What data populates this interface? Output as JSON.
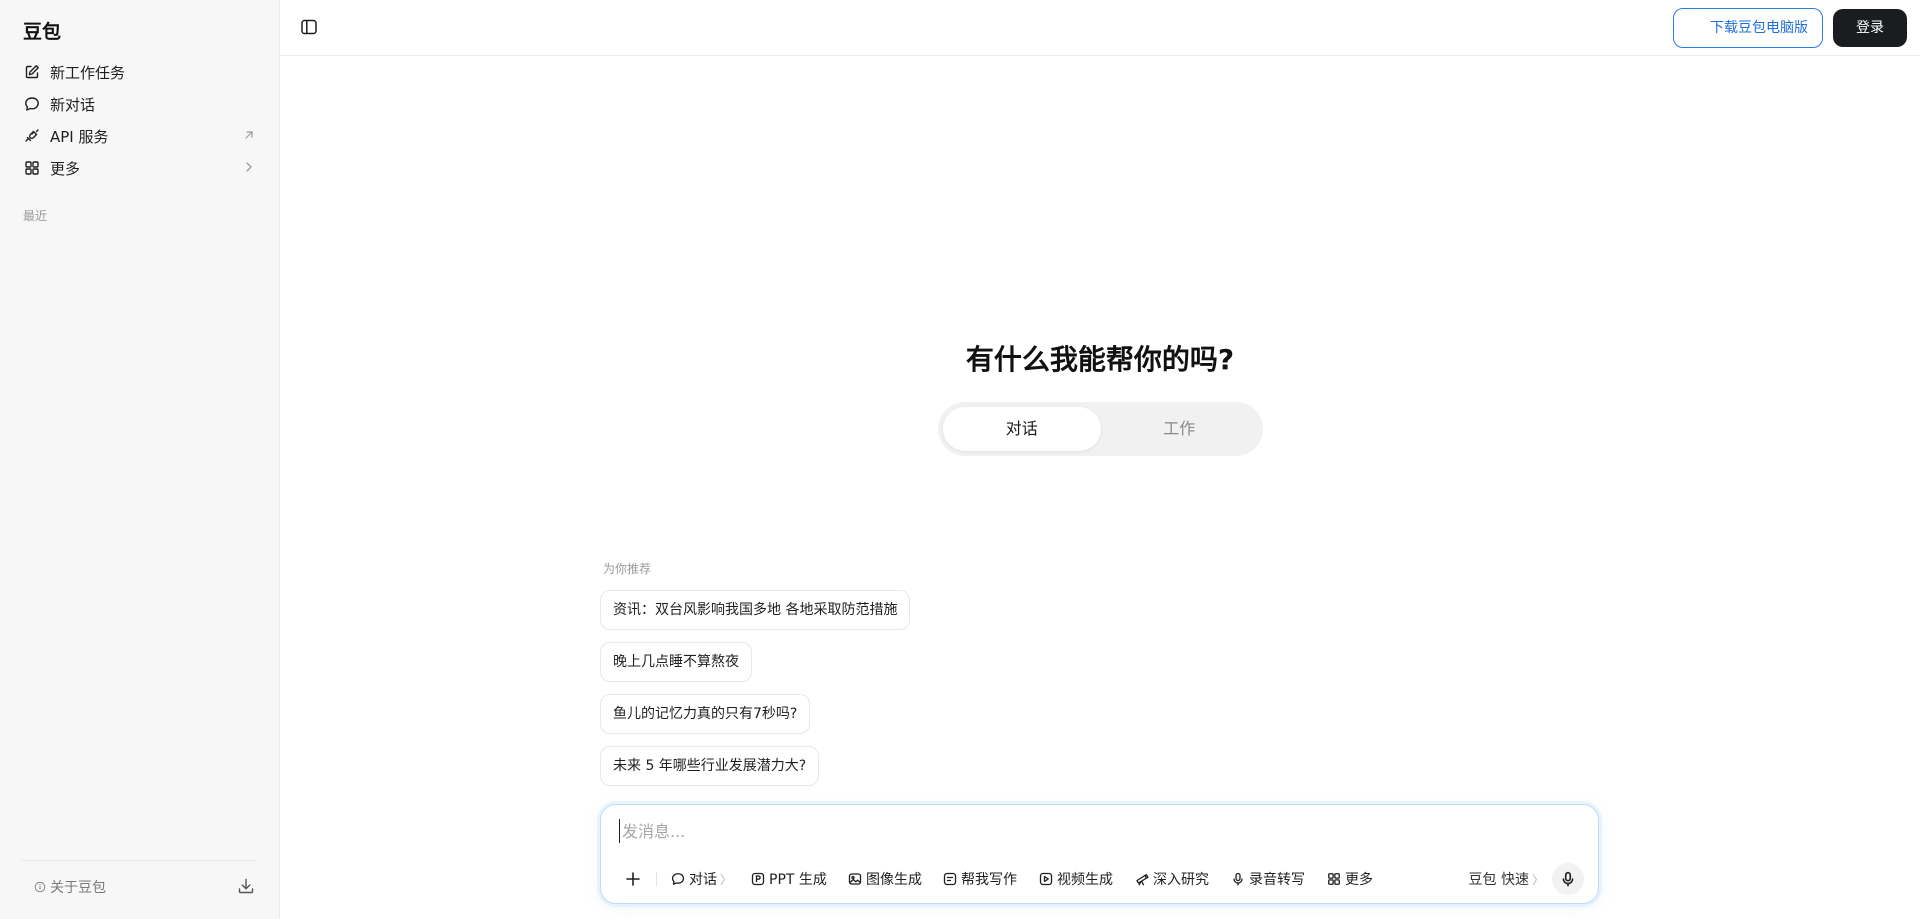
{
  "sidebar": {
    "brand": "豆包",
    "items": [
      {
        "label": "新工作任务",
        "icon": "edit-icon"
      },
      {
        "label": "新对话",
        "icon": "chat-bubble-icon"
      },
      {
        "label": "API 服务",
        "icon": "api-icon",
        "trailing_icon": "external-arrow-icon"
      },
      {
        "label": "更多",
        "icon": "grid-icon",
        "trailing_icon": "chevron-right-icon"
      }
    ],
    "recent_label": "最近",
    "footer": {
      "about_label": "关于豆包",
      "download_icon": "download-icon"
    }
  },
  "topbar": {
    "toggle_icon": "sidebar-toggle-icon",
    "download_button": "下载豆包电脑版",
    "login_button": "登录"
  },
  "main": {
    "headline": "有什么我能帮你的吗?",
    "mode_tabs": [
      {
        "label": "对话",
        "active": true
      },
      {
        "label": "工作",
        "active": false
      }
    ],
    "recommend_label": "为你推荐",
    "suggestions": [
      "资讯：双台风影响我国多地 各地采取防范措施",
      "晚上几点睡不算熬夜",
      "鱼儿的记忆力真的只有7秒吗?",
      "未来 5 年哪些行业发展潜力大?"
    ]
  },
  "composer": {
    "placeholder": "发消息...",
    "value": "",
    "tools": [
      {
        "label": "对话",
        "icon": "chat-bubble-icon",
        "has_chevron": true
      },
      {
        "label": "PPT 生成",
        "icon": "ppt-icon"
      },
      {
        "label": "图像生成",
        "icon": "image-icon"
      },
      {
        "label": "帮我写作",
        "icon": "write-icon"
      },
      {
        "label": "视频生成",
        "icon": "video-icon"
      },
      {
        "label": "深入研究",
        "icon": "telescope-icon"
      },
      {
        "label": "录音转写",
        "icon": "microphone-icon"
      },
      {
        "label": "更多",
        "icon": "grid-icon"
      }
    ],
    "model_label": "豆包 快速",
    "chevron_glyph": "〉"
  },
  "colors": {
    "accent": "#1f6fd9",
    "login_bg": "#1b1c1f",
    "sidebar_bg": "#f7f7f8",
    "composer_border": "#bcdcf6"
  }
}
